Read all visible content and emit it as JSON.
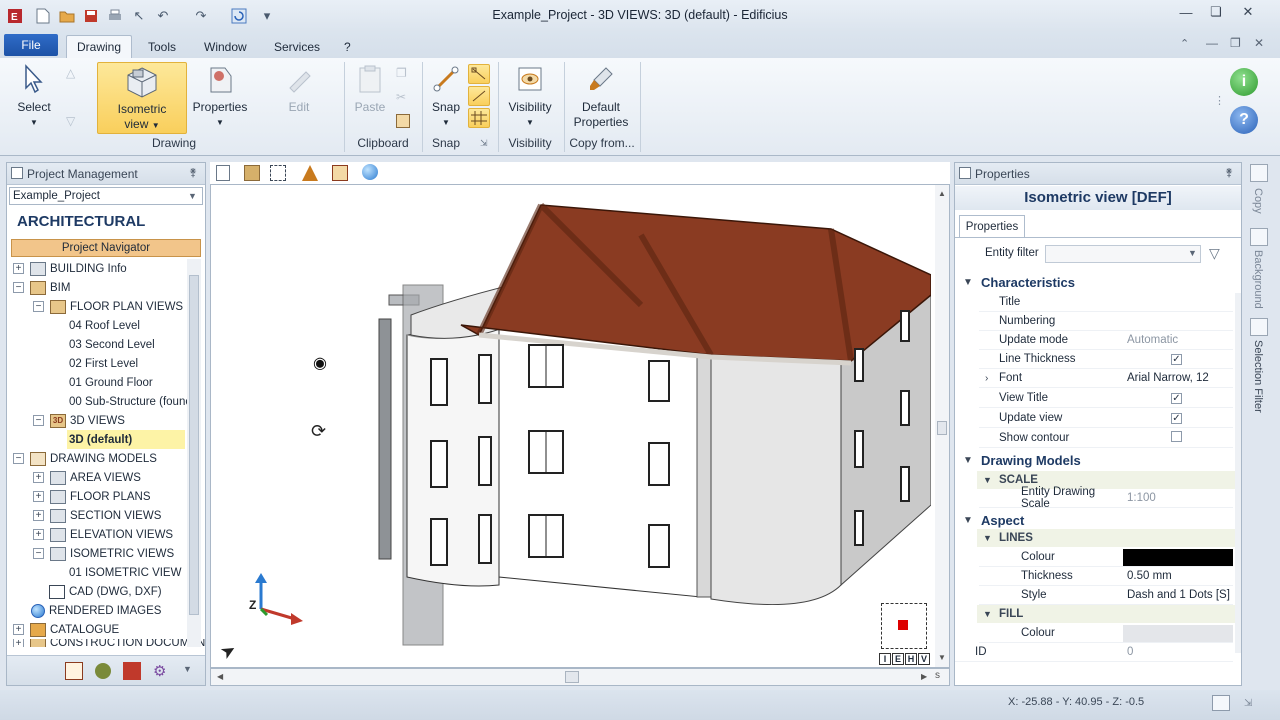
{
  "window": {
    "title": "Example_Project - 3D VIEWS: 3D (default) - Edificius",
    "controls": [
      "minimize",
      "maximize",
      "close"
    ]
  },
  "menu": {
    "file": "File",
    "tabs": [
      "Drawing",
      "Tools",
      "Window",
      "Services",
      "?"
    ],
    "active_tab": "Drawing"
  },
  "ribbon": {
    "select": "Select",
    "isometric": "Isometric view",
    "isometric_line1": "Isometric",
    "isometric_line2": "view",
    "properties": "Properties",
    "edit": "Edit",
    "paste": "Paste",
    "snap": "Snap",
    "visibility": "Visibility",
    "default_props_line1": "Default",
    "default_props_line2": "Properties",
    "groups": {
      "drawing": "Drawing",
      "clipboard": "Clipboard",
      "snap": "Snap",
      "visibility": "Visibility",
      "copy_from": "Copy from..."
    }
  },
  "project_panel": {
    "title": "Project Management",
    "project_select": "Example_Project",
    "section": "ARCHITECTURAL",
    "navigator": "Project Navigator",
    "tree": [
      {
        "label": "BUILDING Info"
      },
      {
        "label": "BIM"
      },
      {
        "label": "FLOOR PLAN VIEWS"
      },
      {
        "label": "04 Roof Level"
      },
      {
        "label": "03 Second Level"
      },
      {
        "label": "02 First Level"
      },
      {
        "label": "01 Ground Floor"
      },
      {
        "label": "00 Sub-Structure (founc"
      },
      {
        "label": "3D VIEWS"
      },
      {
        "label": "3D (default)"
      },
      {
        "label": "DRAWING MODELS"
      },
      {
        "label": "AREA VIEWS"
      },
      {
        "label": "FLOOR PLANS"
      },
      {
        "label": "SECTION VIEWS"
      },
      {
        "label": "ELEVATION VIEWS"
      },
      {
        "label": "ISOMETRIC VIEWS"
      },
      {
        "label": "01 ISOMETRIC VIEW"
      },
      {
        "label": "CAD (DWG, DXF)"
      },
      {
        "label": "RENDERED IMAGES"
      },
      {
        "label": "CATALOGUE"
      },
      {
        "label": "CONSTRUCTION DOCUMEN"
      }
    ]
  },
  "viewport": {
    "nav_cube_letters": [
      "I",
      "E",
      "H",
      "V"
    ],
    "scroll_s": "s"
  },
  "properties_panel": {
    "title": "Properties",
    "object_title": "Isometric view [DEF]",
    "tab": "Properties",
    "entity_filter_label": "Entity filter",
    "sections": {
      "characteristics": "Characteristics",
      "drawing_models": "Drawing Models",
      "aspect": "Aspect"
    },
    "rows": {
      "title": {
        "k": "Title",
        "v": ""
      },
      "numbering": {
        "k": "Numbering",
        "v": ""
      },
      "update_mode": {
        "k": "Update mode",
        "v": "Automatic"
      },
      "line_thickness": {
        "k": "Line Thickness",
        "checked": true
      },
      "font": {
        "k": "Font",
        "v": "Arial Narrow, 12"
      },
      "view_title": {
        "k": "View Title",
        "checked": true
      },
      "update_view": {
        "k": "Update view",
        "checked": true
      },
      "show_contour": {
        "k": "Show contour",
        "checked": false
      },
      "scale": "SCALE",
      "entity_scale": {
        "k": "Entity Drawing Scale",
        "v": "1:100"
      },
      "lines": "LINES",
      "lines_colour": {
        "k": "Colour",
        "color": "#000000"
      },
      "lines_thickness": {
        "k": "Thickness",
        "v": "0.50 mm"
      },
      "lines_style": {
        "k": "Style",
        "v": "Dash and 1 Dots [S]"
      },
      "fill": "FILL",
      "fill_colour": {
        "k": "Colour",
        "color": "#e4e6ea"
      },
      "id": {
        "k": "ID",
        "v": "0"
      }
    },
    "side_tabs": [
      "Copy",
      "Background",
      "Selection Filter"
    ]
  },
  "status": {
    "coords": "X: -25.88 - Y: 40.95 - Z: -0.5"
  },
  "colors": {
    "accent": "#1d52a6",
    "highlight": "#fde89a",
    "roof": "#8a3b22",
    "navigator": "#f2c58a"
  }
}
